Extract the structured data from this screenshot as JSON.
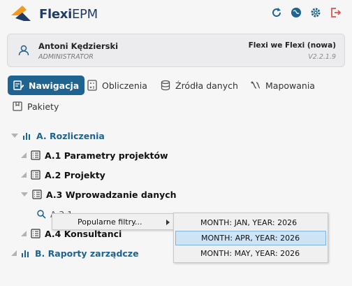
{
  "header": {
    "brand_bold": "Flexi",
    "brand_rest": "EPM",
    "icons": [
      "refresh-icon",
      "globe-icon",
      "gear-icon",
      "logout-icon"
    ],
    "accent": "#1f6391",
    "logo_orange": "#f39a1e"
  },
  "user": {
    "name": "Antoni Kędzierski",
    "role": "ADMINISTRATOR",
    "org": "Flexi we Flexi (nowa)",
    "version": "V2.2.1.9"
  },
  "tabs": [
    {
      "label": "Nawigacja",
      "active": true
    },
    {
      "label": "Obliczenia"
    },
    {
      "label": "Źródła danych"
    },
    {
      "label": "Mapowania"
    },
    {
      "label": "Pakiety"
    }
  ],
  "tree": {
    "a": "A. Rozliczenia",
    "a1": "A.1 Parametry projektów",
    "a2": "A.2 Projekty",
    "a3": "A.3 Wprowadzanie danych",
    "a31_visible": "A.3.1",
    "a4": "A.4 Konsultanci",
    "b": "B. Raporty zarządcze"
  },
  "context_menu": {
    "item": "Popularne filtry..."
  },
  "submenu": [
    "MONTH: JAN, YEAR: 2026",
    "MONTH: APR, YEAR: 2026",
    "MONTH: MAY, YEAR: 2026"
  ]
}
